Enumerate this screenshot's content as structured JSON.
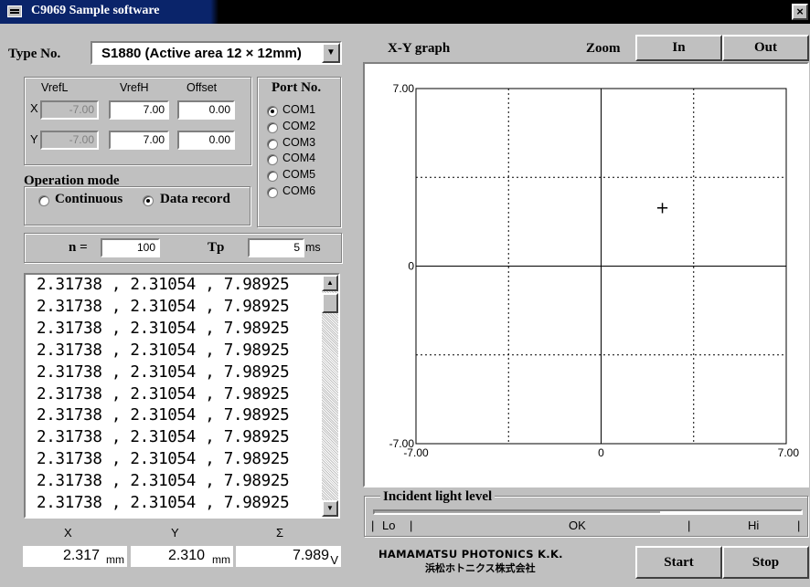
{
  "window": {
    "title": "C9069 Sample software",
    "close_glyph": "×"
  },
  "type_no": {
    "label": "Type No.",
    "selected": "S1880 (Active area 12 × 12mm)",
    "dropdown_glyph": "▼"
  },
  "vref": {
    "headers": [
      "VrefL",
      "VrefH",
      "Offset"
    ],
    "rows": [
      {
        "axis": "X",
        "vrefl": "-7.00",
        "vrefh": "7.00",
        "offset": "0.00"
      },
      {
        "axis": "Y",
        "vrefl": "-7.00",
        "vrefh": "7.00",
        "offset": "0.00"
      }
    ]
  },
  "port": {
    "title": "Port No.",
    "options": [
      "COM1",
      "COM2",
      "COM3",
      "COM4",
      "COM5",
      "COM6"
    ],
    "selected": "COM1"
  },
  "operation_mode": {
    "title": "Operation mode",
    "options": [
      "Continuous",
      "Data record"
    ],
    "selected": "Data record"
  },
  "params": {
    "n_label": "n =",
    "n_value": "100",
    "tp_label": "Tp",
    "tp_value": "5",
    "tp_unit": "ms"
  },
  "data_list": {
    "rows": [
      "2.31738 , 2.31054 , 7.98925",
      "2.31738 , 2.31054 , 7.98925",
      "2.31738 , 2.31054 , 7.98925",
      "2.31738 , 2.31054 , 7.98925",
      "2.31738 , 2.31054 , 7.98925",
      "2.31738 , 2.31054 , 7.98925",
      "2.31738 , 2.31054 , 7.98925",
      "2.31738 , 2.31054 , 7.98925",
      "2.31738 , 2.31054 , 7.98925",
      "2.31738 , 2.31054 , 7.98925",
      "2.31738 , 2.31054 , 7.98925"
    ],
    "scroll_up_glyph": "▲",
    "scroll_down_glyph": "▼"
  },
  "readout": {
    "x": {
      "label": "X",
      "value": "2.317",
      "unit": "mm"
    },
    "y": {
      "label": "Y",
      "value": "2.310",
      "unit": "mm"
    },
    "sigma": {
      "label": "Σ",
      "value": "7.989",
      "unit": "V"
    }
  },
  "graph": {
    "title": "X-Y graph",
    "zoom_label": "Zoom",
    "zoom_in": "In",
    "zoom_out": "Out",
    "y_ticks": [
      "7.00",
      "0",
      "-7.00"
    ],
    "x_ticks": [
      "-7.00",
      "0",
      "7.00"
    ],
    "marker_glyph": "+"
  },
  "chart_data": {
    "type": "scatter",
    "xlim": [
      -7,
      7
    ],
    "ylim": [
      -7,
      7
    ],
    "x_ticks": [
      "-7.00",
      "0",
      "7.00"
    ],
    "y_ticks": [
      "-7.00",
      "0",
      "7.00"
    ],
    "grid": true,
    "points": [
      {
        "x": 2.317,
        "y": 2.31
      }
    ]
  },
  "light_level": {
    "title": "Incident light level",
    "level": 0.67,
    "scale_lo": "Lo",
    "scale_ok": "OK",
    "scale_hi": "Hi"
  },
  "brand": {
    "line1": "HAMAMATSU PHOTONICS K.K.",
    "line2": "浜松ホトニクス株式会社"
  },
  "actions": {
    "start": "Start",
    "stop": "Stop"
  },
  "colors": {
    "titlebar": "#0a246a",
    "face": "#c0c0c0",
    "grid": "#000000"
  }
}
